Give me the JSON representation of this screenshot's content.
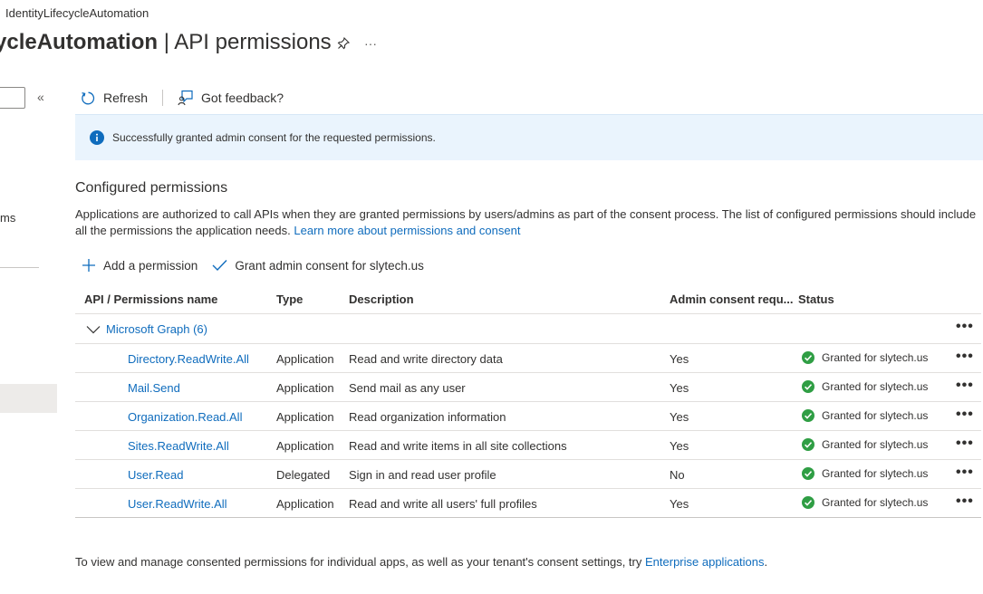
{
  "breadcrumb": "IdentityLifecycleAutomation",
  "title": {
    "app_name": "ycleAutomation",
    "separator": " | ",
    "page": "API permissions"
  },
  "title_icons": {
    "pin": "pin-icon",
    "more": "···"
  },
  "nav": {
    "collapse_glyph": "«",
    "item_fragment": "ms"
  },
  "toolbar": {
    "refresh_label": "Refresh",
    "feedback_label": "Got feedback?"
  },
  "banner": {
    "message": "Successfully granted admin consent for the requested permissions."
  },
  "section": {
    "title": "Configured permissions",
    "description": "Applications are authorized to call APIs when they are granted permissions by users/admins as part of the consent process. The list of configured permissions should include all the permissions the application needs.",
    "learn_more": "Learn more about permissions and consent"
  },
  "actions": {
    "add_permission": "Add a permission",
    "grant_consent": "Grant admin consent for slytech.us"
  },
  "table": {
    "headers": {
      "name": "API / Permissions name",
      "type": "Type",
      "description": "Description",
      "admin": "Admin consent requ...",
      "status": "Status"
    },
    "group": {
      "label": "Microsoft Graph (6)",
      "more": "•••"
    },
    "rows": [
      {
        "name": "Directory.ReadWrite.All",
        "type": "Application",
        "description": "Read and write directory data",
        "admin": "Yes",
        "status": "Granted for slytech.us",
        "more": "•••"
      },
      {
        "name": "Mail.Send",
        "type": "Application",
        "description": "Send mail as any user",
        "admin": "Yes",
        "status": "Granted for slytech.us",
        "more": "•••"
      },
      {
        "name": "Organization.Read.All",
        "type": "Application",
        "description": "Read organization information",
        "admin": "Yes",
        "status": "Granted for slytech.us",
        "more": "•••"
      },
      {
        "name": "Sites.ReadWrite.All",
        "type": "Application",
        "description": "Read and write items in all site collections",
        "admin": "Yes",
        "status": "Granted for slytech.us",
        "more": "•••"
      },
      {
        "name": "User.Read",
        "type": "Delegated",
        "description": "Sign in and read user profile",
        "admin": "No",
        "status": "Granted for slytech.us",
        "more": "•••"
      },
      {
        "name": "User.ReadWrite.All",
        "type": "Application",
        "description": "Read and write all users' full profiles",
        "admin": "Yes",
        "status": "Granted for slytech.us",
        "more": "•••"
      }
    ]
  },
  "footer": {
    "text": "To view and manage consented permissions for individual apps, as well as your tenant's consent settings, try",
    "link": "Enterprise applications",
    "end": "."
  },
  "colors": {
    "link": "#0f6cbd",
    "success": "#2f9e44",
    "banner_bg": "#eaf4fd",
    "info_icon": "#0f6cbd"
  }
}
